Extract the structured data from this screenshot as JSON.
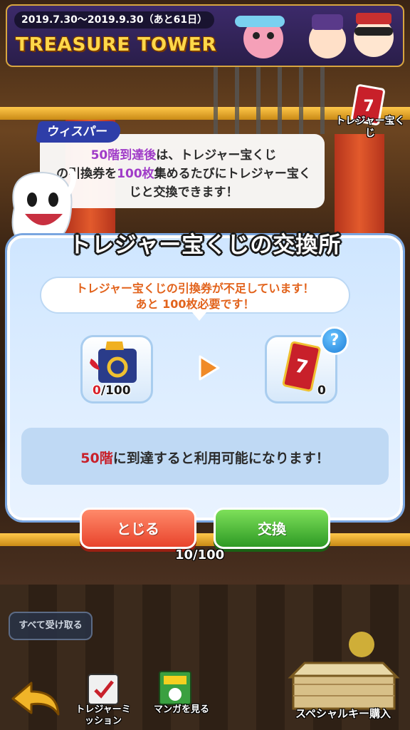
{
  "banner": {
    "date_range": "2019.7.30～2019.9.30（あと61日）",
    "title": "TREASURE TOWER"
  },
  "side_ticket": {
    "label": "トレジャー宝くじ"
  },
  "whisper": {
    "name": "ウィスパー",
    "highlight_floor": "50階到達後",
    "text_part1": "は、トレジャー宝くじ",
    "text_part2": "の引換券を",
    "highlight_count": "100枚",
    "text_part3": "集めるたびにトレジャー宝くじと交換できます！"
  },
  "dialog": {
    "title": "トレジャー宝くじの交換所",
    "notice_line1": "トレジャー宝くじの引換券が不足しています！",
    "notice_line2_prefix": "あと ",
    "notice_line2_count": "100枚",
    "notice_line2_suffix": "必要です！",
    "voucher_owned": "0",
    "voucher_required": "/100",
    "ticket_owned": "0",
    "help_label": "?",
    "unlock_floor": "50階",
    "unlock_text": "に到達すると利用可能になります！",
    "close_label": "とじる",
    "exchange_label": "交換"
  },
  "hud": {
    "progress": "10/100",
    "claim_all": "すべて受け取る",
    "mission_label": "トレジャーミッション",
    "manga_label": "マンガを見る",
    "special_key_label": "スペシャルキー購入"
  },
  "colors": {
    "accent_purple": "#a03cc8",
    "warning_orange": "#e2631c",
    "alert_red": "#c8202a",
    "close_button": "#e8442c",
    "exchange_button": "#2e9a24"
  }
}
